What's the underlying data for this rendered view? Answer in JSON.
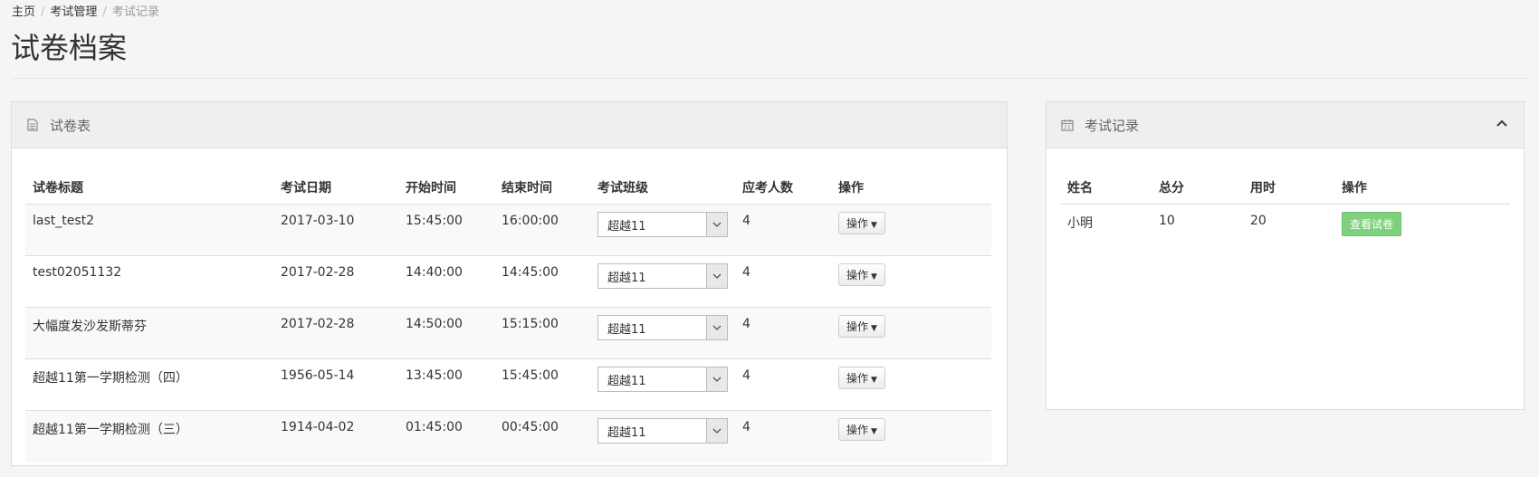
{
  "breadcrumb": {
    "home": "主页",
    "exam_mgmt": "考试管理",
    "current": "考试记录"
  },
  "page_title": "试卷档案",
  "papers_panel": {
    "title": "试卷表",
    "columns": [
      "试卷标题",
      "考试日期",
      "开始时间",
      "结束时间",
      "考试班级",
      "应考人数",
      "操作"
    ],
    "rows": [
      {
        "title": "last_test2",
        "date": "2017-03-10",
        "start": "15:45:00",
        "end": "16:00:00",
        "class": "超越11",
        "count": "4",
        "op": "操作"
      },
      {
        "title": "test02051132",
        "date": "2017-02-28",
        "start": "14:40:00",
        "end": "14:45:00",
        "class": "超越11",
        "count": "4",
        "op": "操作"
      },
      {
        "title": "大幅度发沙发斯蒂芬",
        "date": "2017-02-28",
        "start": "14:50:00",
        "end": "15:15:00",
        "class": "超越11",
        "count": "4",
        "op": "操作"
      },
      {
        "title": "超越11第一学期检测（四）",
        "date": "1956-05-14",
        "start": "13:45:00",
        "end": "15:45:00",
        "class": "超越11",
        "count": "4",
        "op": "操作"
      },
      {
        "title": "超越11第一学期检测（三）",
        "date": "1914-04-02",
        "start": "01:45:00",
        "end": "00:45:00",
        "class": "超越11",
        "count": "4",
        "op": "操作"
      }
    ]
  },
  "records_panel": {
    "title": "考试记录",
    "columns": [
      "姓名",
      "总分",
      "用时",
      "操作"
    ],
    "rows": [
      {
        "name": "小明",
        "score": "10",
        "time": "20",
        "action": "查看试卷"
      }
    ]
  },
  "colors": {
    "view_button": "#7fd07f",
    "panel_header": "#efefef"
  },
  "icons": {
    "papers": "file-text-icon",
    "records": "calendar-icon",
    "collapse": "chevron-up-icon"
  }
}
